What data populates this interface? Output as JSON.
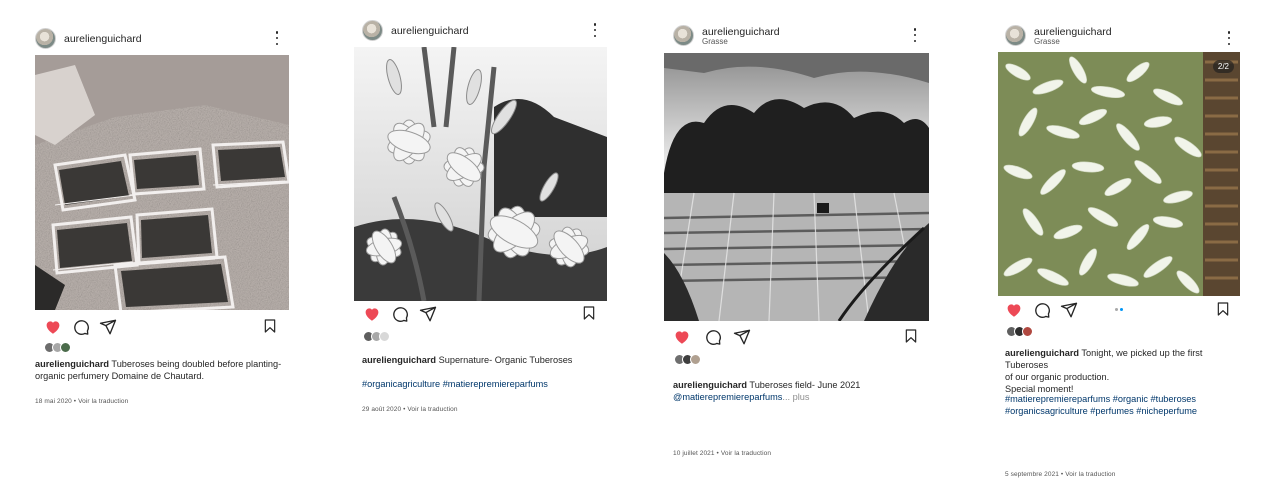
{
  "posts": [
    {
      "username": "aurelienguichard",
      "caption_text": "Tuberoses being doubled before planting-",
      "caption_line2": "organic perfumery Domaine de Chautard.",
      "date": "18 mai 2020",
      "translate": "Voir la traduction"
    },
    {
      "username": "aurelienguichard",
      "caption_text": "Supernature- Organic Tuberoses",
      "hashtags": "#organicagriculture #matierepremiereparfums",
      "date": "29 août 2020",
      "translate": "Voir la traduction"
    },
    {
      "username": "aurelienguichard",
      "location": "Grasse",
      "caption_text": "Tuberoses field- June 2021",
      "mention": "@matierepremiereparfums",
      "more": "... plus",
      "date": "10 juillet 2021",
      "translate": "Voir la traduction"
    },
    {
      "username": "aurelienguichard",
      "location": "Grasse",
      "counter": "2/2",
      "caption_text": "Tonight, we picked up the first Tuberoses",
      "caption_line2": "of our organic production.",
      "caption_line3": "Special moment!",
      "hashtags_line1": "#matierepremiereparfums #organic #tuberoses",
      "hashtags_line2": "#organicsagriculture #perfumes #nicheperfume",
      "date": "5 septembre 2021",
      "translate": "Voir la traduction"
    }
  ],
  "separator": "•",
  "colors": {
    "like": "#ed4956",
    "hashtag": "#00376b",
    "text": "#262626",
    "carousel_dot_active": "#0095f6"
  },
  "icons": [
    "more-icon",
    "heart-icon",
    "comment-icon",
    "share-icon",
    "bookmark-icon"
  ]
}
